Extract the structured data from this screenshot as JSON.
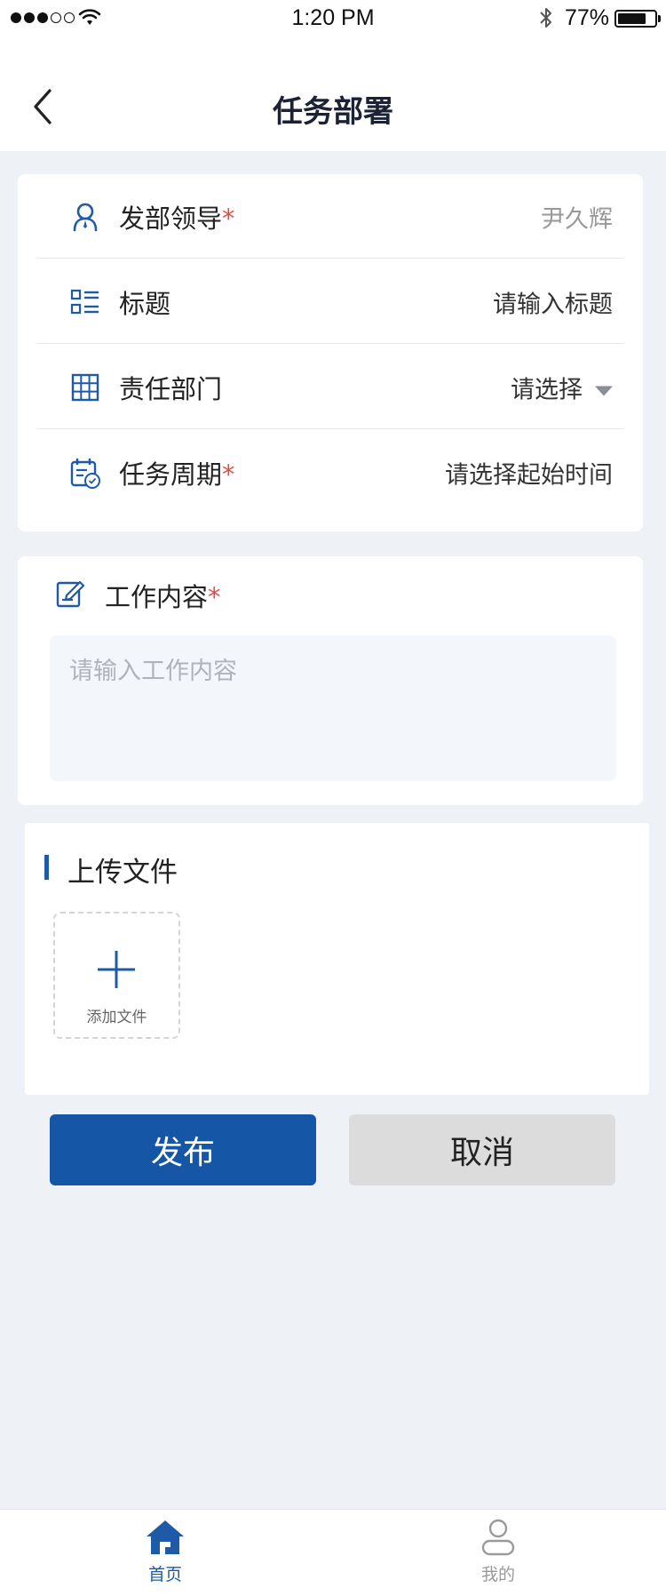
{
  "status_bar": {
    "time": "1:20 PM",
    "battery_percent": "77%",
    "battery_level": 0.77,
    "signal_bars_filled": 3,
    "signal_bars_total": 5
  },
  "nav": {
    "title": "任务部署"
  },
  "form": {
    "leader": {
      "label": "发部领导",
      "required_mark": "*",
      "value": "尹久辉",
      "icon": "user-icon"
    },
    "title": {
      "label": "标题",
      "placeholder": "请输入标题",
      "icon": "list-icon"
    },
    "department": {
      "label": "责任部门",
      "placeholder": "请选择",
      "icon": "grid-icon"
    },
    "period": {
      "label": "任务周期",
      "required_mark": "*",
      "placeholder": "请选择起始时间",
      "icon": "calendar-start-icon"
    },
    "content": {
      "label": "工作内容",
      "required_mark": "*",
      "placeholder": "请输入工作内容",
      "icon": "edit-icon"
    }
  },
  "upload": {
    "title": "上传文件",
    "add_label": "添加文件"
  },
  "actions": {
    "publish_label": "发布",
    "cancel_label": "取消"
  },
  "tabbar": {
    "items": [
      {
        "label": "首页",
        "icon": "home-icon",
        "active": true
      },
      {
        "label": "我的",
        "icon": "profile-icon",
        "active": false
      }
    ]
  },
  "colors": {
    "accent": "#1656a6",
    "required": "#e34d4d",
    "background": "#eef2f6"
  }
}
